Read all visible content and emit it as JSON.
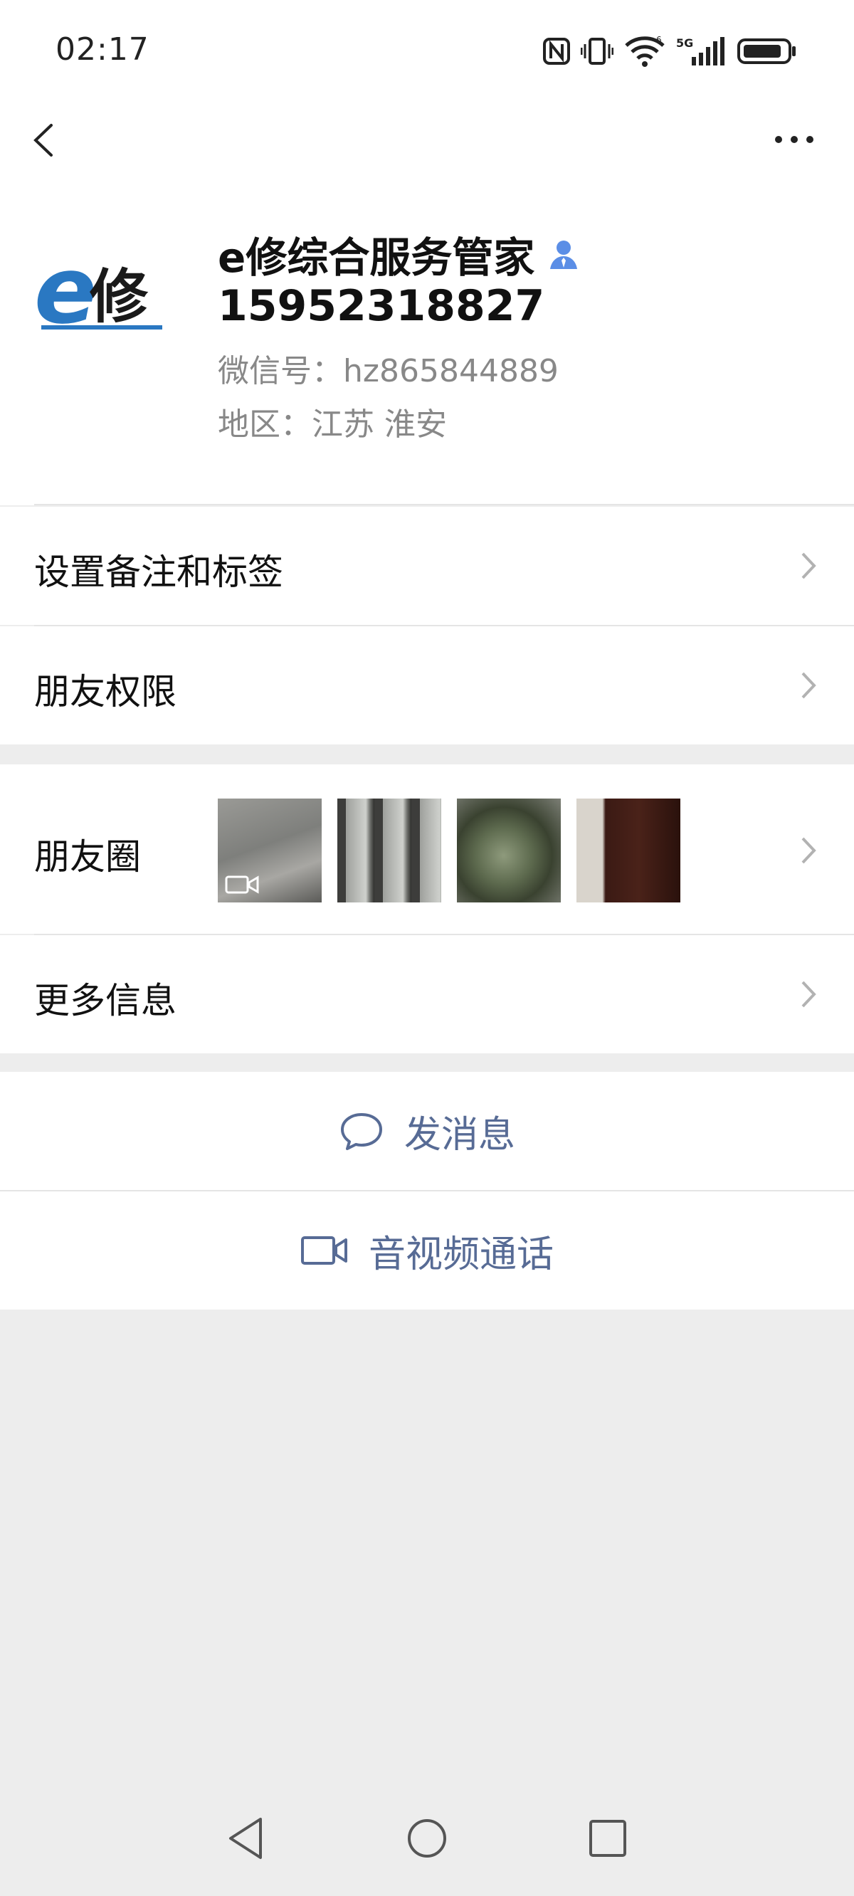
{
  "status": {
    "time": "02:17"
  },
  "profile": {
    "name": "e修综合服务管家",
    "phone": "15952318827",
    "wechat_id": "微信号：hz865844889",
    "region": "地区：江苏  淮安",
    "logo_text": "e修"
  },
  "rows": {
    "remark": "设置备注和标签",
    "permission": "朋友权限",
    "moments": "朋友圈",
    "more_info": "更多信息"
  },
  "actions": {
    "message": "发消息",
    "call": "音视频通话"
  },
  "colors": {
    "accent": "#576b95",
    "background": "#ededed"
  },
  "icons": [
    "back-arrow-icon",
    "more-icon",
    "verified-person-icon",
    "chevron-right-icon",
    "chat-bubble-icon",
    "video-camera-icon",
    "nav-back-icon",
    "nav-home-icon",
    "nav-recents-icon"
  ]
}
